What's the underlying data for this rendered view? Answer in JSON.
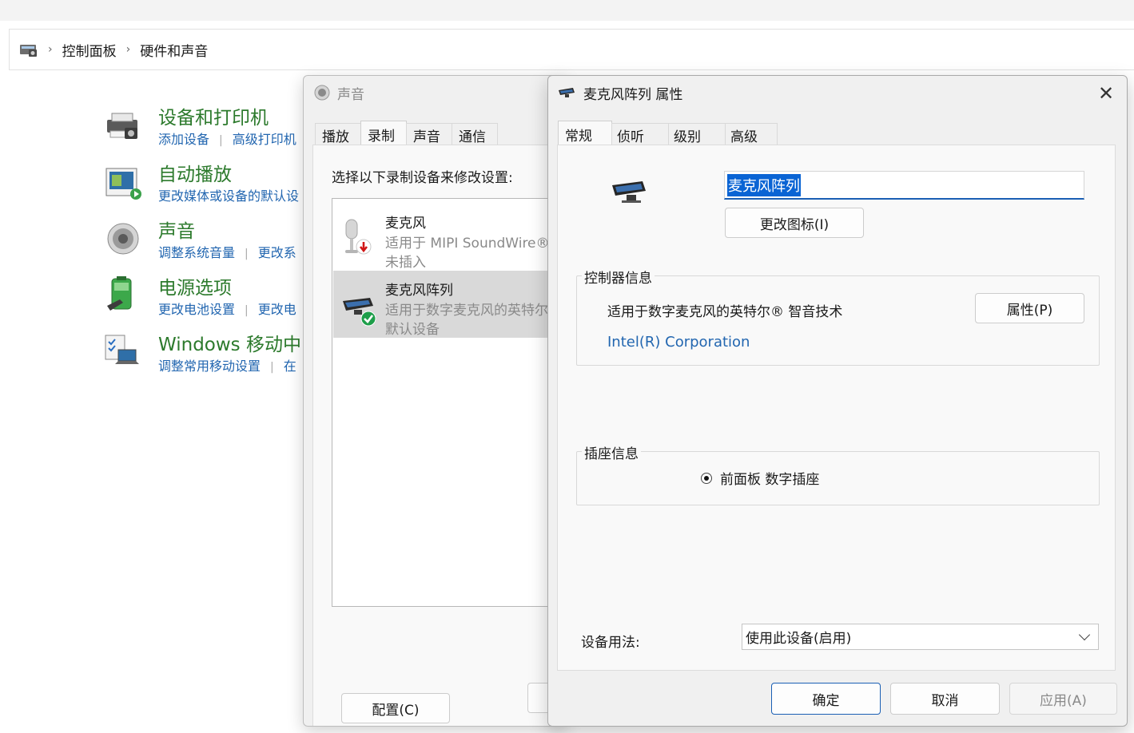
{
  "breadcrumb": {
    "items": [
      "控制面板",
      "硬件和声音"
    ]
  },
  "control_panel": {
    "items": [
      {
        "title": "设备和打印机",
        "links": [
          "添加设备",
          "高级打印机"
        ]
      },
      {
        "title": "自动播放",
        "links": [
          "更改媒体或设备的默认设"
        ]
      },
      {
        "title": "声音",
        "links": [
          "调整系统音量",
          "更改系"
        ]
      },
      {
        "title": "电源选项",
        "links": [
          "更改电池设置",
          "更改电"
        ]
      },
      {
        "title": "Windows 移动中",
        "links": [
          "调整常用移动设置",
          "在"
        ]
      }
    ]
  },
  "sound_dialog": {
    "title": "声音",
    "tabs": [
      "播放",
      "录制",
      "声音",
      "通信"
    ],
    "active_tab": "录制",
    "instruction": "选择以下录制设备来修改设置:",
    "devices": [
      {
        "name": "麦克风",
        "desc": "适用于 MIPI SoundWire®",
        "state": "未插入",
        "status_icon": "unplugged-arrow-icon"
      },
      {
        "name": "麦克风阵列",
        "desc": "适用于数字麦克风的英特尔",
        "state": "默认设备",
        "status_icon": "default-check-icon",
        "selected": true
      }
    ],
    "configure_button": "配置(C)"
  },
  "properties_dialog": {
    "title": "麦克风阵列 属性",
    "tabs": [
      "常规",
      "侦听",
      "级别",
      "高级"
    ],
    "active_tab": "常规",
    "device_name_value": "麦克风阵列",
    "change_icon_button": "更改图标(I)",
    "controller_group": {
      "legend": "控制器信息",
      "name": "适用于数字麦克风的英特尔® 智音技术",
      "vendor": "Intel(R) Corporation",
      "properties_button": "属性(P)"
    },
    "jack_group": {
      "legend": "插座信息",
      "jack": "前面板 数字插座"
    },
    "usage_label": "设备用法:",
    "usage_value": "使用此设备(启用)",
    "buttons": {
      "ok": "确定",
      "cancel": "取消",
      "apply": "应用(A)"
    }
  },
  "colors": {
    "link_blue": "#2266b0",
    "title_green": "#2c7a2c",
    "accent": "#1a5fb4",
    "selection": "#0a64d4"
  }
}
